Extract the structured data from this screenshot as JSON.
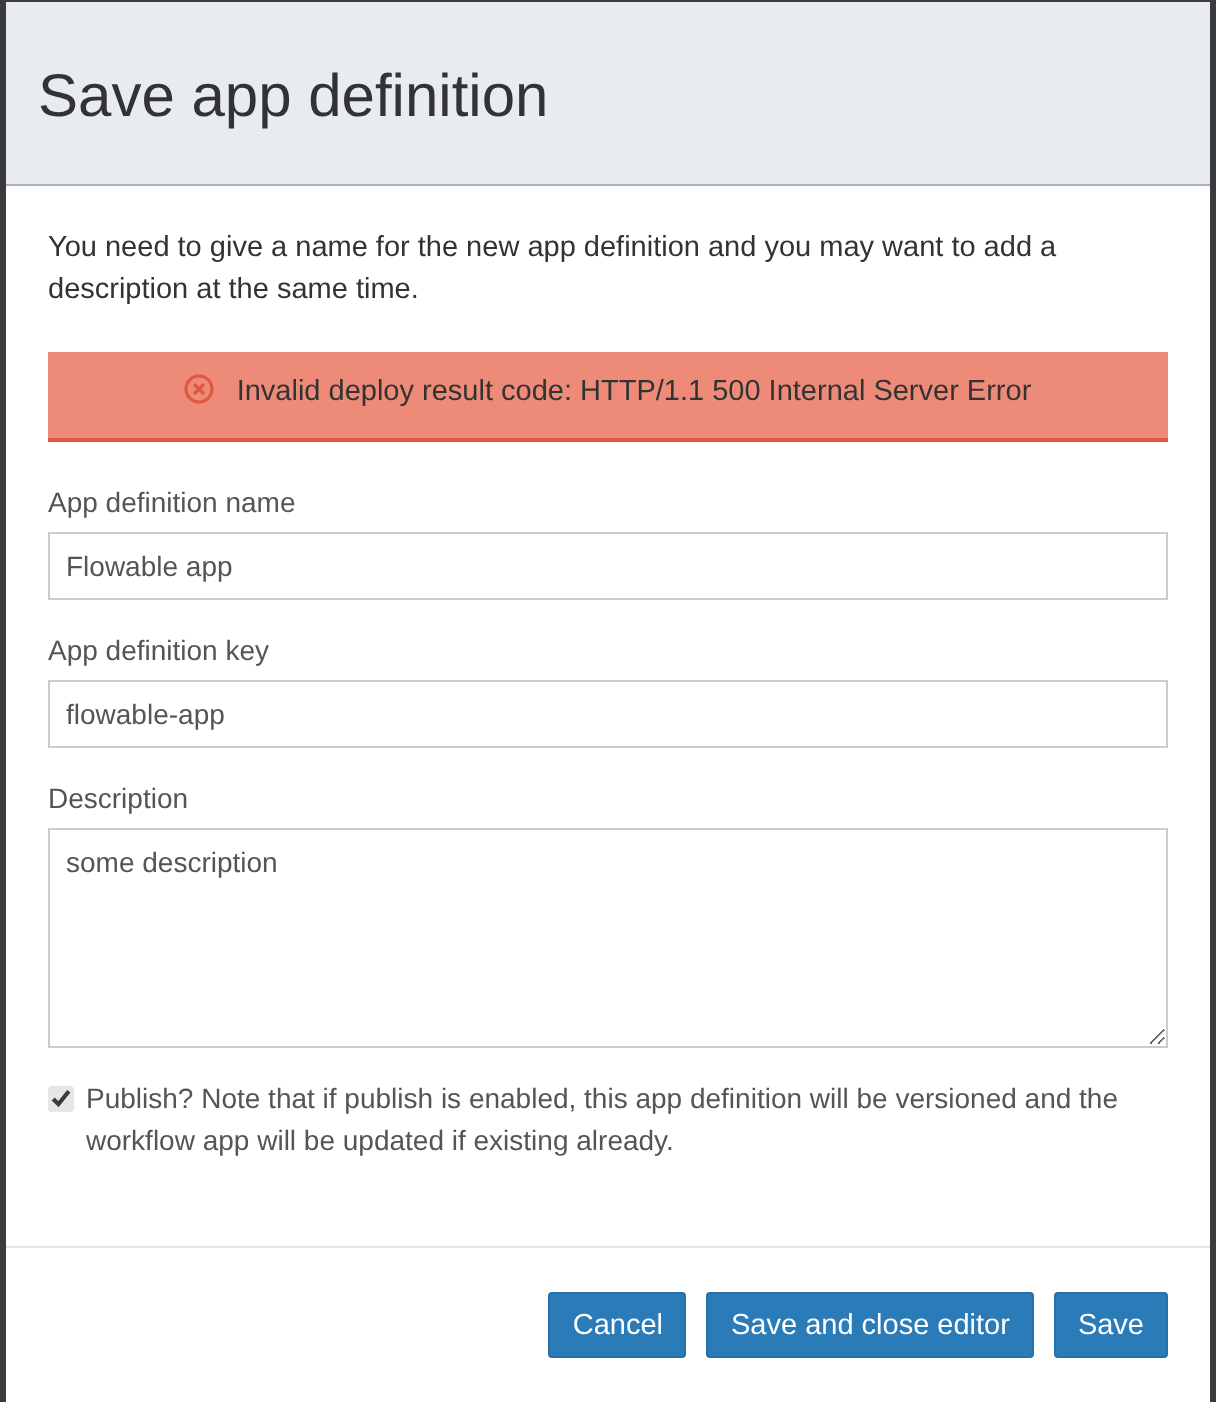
{
  "header": {
    "title": "Save app definition"
  },
  "intro": "You need to give a name for the new app definition and you may want to add a description at the same time.",
  "alert": {
    "message": "Invalid deploy result code: HTTP/1.1 500 Internal Server Error"
  },
  "fields": [
    {
      "kind": "input",
      "label": "App definition name",
      "value": "Flowable app"
    },
    {
      "kind": "input",
      "label": "App definition key",
      "value": "flowable-app"
    },
    {
      "kind": "textarea",
      "label": "Description",
      "value": "some description"
    }
  ],
  "publish": {
    "checked": true,
    "label": "Publish? Note that if publish is enabled, this app definition will be versioned and the workflow app will be updated if existing already."
  },
  "buttons": [
    {
      "label": "Cancel"
    },
    {
      "label": "Save and close editor"
    },
    {
      "label": "Save"
    }
  ]
}
